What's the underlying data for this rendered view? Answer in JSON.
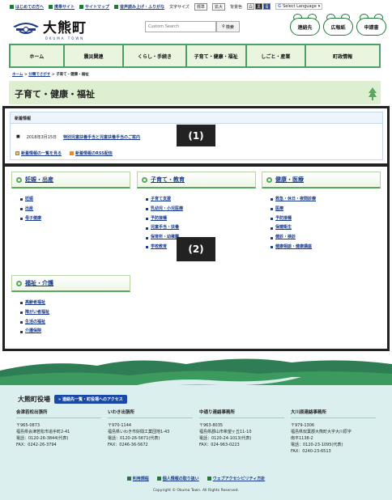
{
  "utility": {
    "links": [
      "はじめての方へ",
      "携帯サイト",
      "サイトマップ",
      "音声読み上げ・ふりがな"
    ],
    "font_size_label": "文字サイズ",
    "font_size_options": [
      "標準",
      "拡大"
    ],
    "bg_label": "背景色",
    "bg_options": [
      "白",
      "黒",
      "青"
    ],
    "translate_label": "Select Language"
  },
  "header": {
    "logo_text": "大熊町",
    "logo_sub": "OKUMA TOWN",
    "search_placeholder": "Custom Search",
    "search_button": "検索",
    "quick_links": [
      "連絡先",
      "広報紙",
      "申請書"
    ]
  },
  "gnav": [
    "ホーム",
    "震災関連",
    "くらし・手続き",
    "子育て・健康・福祉",
    "しごと・産業",
    "町政情報"
  ],
  "breadcrumb": [
    "ホーム",
    "分類でさがす",
    "子育て・健康・福祉"
  ],
  "page_title": "子育て・健康・福祉",
  "news": {
    "header": "新着情報",
    "date": "2018年3月15日",
    "title": "特別児童扶養手当と児童扶養手当のご案内",
    "list_link": "新着情報の一覧を見る",
    "rss_link": "新着情報のRSS配信"
  },
  "callouts": [
    "(1)",
    "(2)"
  ],
  "categories": [
    {
      "title": "妊娠・出産",
      "items": [
        "妊娠",
        "出産",
        "母子健康"
      ]
    },
    {
      "title": "子育て・教育",
      "items": [
        "子育て支援",
        "乳幼児・小児医療",
        "予防接種",
        "児童手当・扶養",
        "保育所・幼稚園",
        "学校教育"
      ]
    },
    {
      "title": "健康・医療",
      "items": [
        "救急・休日・夜間診療",
        "医療",
        "予防接種",
        "保健衛生",
        "健診・検診",
        "健康相談・健康講座"
      ]
    },
    {
      "title": "福祉・介護",
      "items": [
        "高齢者福祉",
        "障がい者福祉",
        "生活の福祉",
        "介護保険"
      ]
    }
  ],
  "footer": {
    "office_name": "大熊町役場",
    "office_button": "連絡先一覧・町役場へのアクセス",
    "offices": [
      {
        "name": "会津若松出張所",
        "zip": "〒965-0873",
        "addr": "福島県会津若松市追手町2-41",
        "tel": "電話：0120-26-3844(代表)",
        "fax": "FAX：0242-26-3794",
        "addr2": ""
      },
      {
        "name": "いわき出張所",
        "zip": "〒970-1144",
        "addr": "福島県いわき市好間工業団地1-43",
        "tel": "電話：0120-26-5671(代表)",
        "fax": "FAX：0246-36-5672",
        "addr2": ""
      },
      {
        "name": "中通り連絡事務所",
        "zip": "〒963-8035",
        "addr": "福島県郡山市希望ヶ丘11-10",
        "tel": "電話：0120-24-1013(代表)",
        "fax": "FAX：024-963-0223",
        "addr2": ""
      },
      {
        "name": "大川原連絡事務所",
        "zip": "〒979-1306",
        "addr": "福島県双葉郡大熊町大字大川原字",
        "addr2": "南平1138-2",
        "tel": "電話：0120-23-1095(代表)",
        "fax": "FAX：0240-23-6513"
      }
    ],
    "links": [
      "利用規程",
      "個人情報の取り扱い",
      "ウェブアクセシビリティ方針"
    ],
    "copyright": "Copyright © Okuma Town. All Rights Reserved."
  }
}
